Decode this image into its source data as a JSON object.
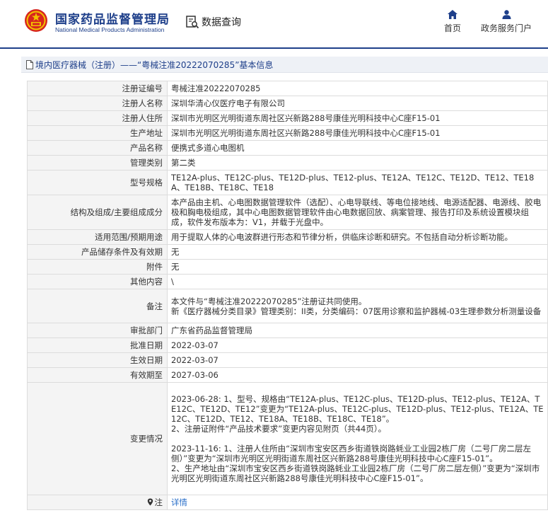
{
  "header": {
    "brand_cn": "国家药品监督管理局",
    "brand_en": "National Medical Products Administration",
    "query_label": "数据查询",
    "nav": {
      "home": "首页",
      "portal": "政务服务门户"
    },
    "accent_color": "#1e3f8a"
  },
  "breadcrumb": {
    "text": "境内医疗器械（注册）——“粤械注准20222070285”基本信息"
  },
  "rows": [
    {
      "label": "注册证编号",
      "value": "粤械注准20222070285"
    },
    {
      "label": "注册人名称",
      "value": "深圳华清心仪医疗电子有限公司"
    },
    {
      "label": "注册人住所",
      "value": "深圳市光明区光明街道东周社区兴新路288号康佳光明科技中心C座F15-01"
    },
    {
      "label": "生产地址",
      "value": "深圳市光明区光明街道东周社区兴新路288号康佳光明科技中心C座F15-01"
    },
    {
      "label": "产品名称",
      "value": "便携式多道心电图机"
    },
    {
      "label": "管理类别",
      "value": "第二类"
    },
    {
      "label": "型号规格",
      "value": "TE12A-plus、TE12C-plus、TE12D-plus、TE12-plus、TE12A、TE12C、TE12D、TE12、TE18A、TE18B、TE18C、TE18"
    },
    {
      "label": "结构及组成/主要组成成分",
      "value": "本产品由主机、心电图数据管理软件（选配）、心电导联线、等电位接地线、电源适配器、电源线、胶电极和胸电极组成，其中心电图数据管理软件由心电数据回放、病案管理、报告打印及系统设置模块组成，软件发布版本为：V1，并载于光盘中。"
    },
    {
      "label": "适用范围/预期用途",
      "value": "用于提取人体的心电波群进行形态和节律分析，供临床诊断和研究。不包括自动分析诊断功能。"
    },
    {
      "label": "产品储存条件及有效期",
      "value": "无"
    },
    {
      "label": "附件",
      "value": "无"
    },
    {
      "label": "其他内容",
      "value": "\\"
    },
    {
      "label": "备注",
      "lines": [
        "本文件与“粤械注准20222070285”注册证共同使用。",
        "新《医疗器械分类目录》管理类别：II类，分类编码：07医用诊察和监护器械-03生理参数分析测量设备"
      ]
    },
    {
      "label": "审批部门",
      "value": "广东省药品监督管理局"
    },
    {
      "label": "批准日期",
      "value": "2022-03-07"
    },
    {
      "label": "生效日期",
      "value": "2022-03-07"
    },
    {
      "label": "有效期至",
      "value": "2027-03-06"
    },
    {
      "label": "变更情况",
      "lines": [
        "2023-06-28: 1、型号、规格由“TE12A-plus、TE12C-plus、TE12D-plus、TE12-plus、TE12A、TE12C、TE12D、TE12”变更为“TE12A-plus、TE12C-plus、TE12D-plus、TE12-plus、TE12A、TE12C、TE12D、TE12、TE18A、TE18B、TE18C、TE18”。",
        "2、注册证附件“产品技术要求”变更内容见附页（共44页）。",
        "",
        "2023-11-16: 1、注册人住所由“深圳市宝安区西乡街道铁岗路蚝业工业园2栋厂房（二号厂房二层左侧）”变更为“深圳市光明区光明街道东周社区兴新路288号康佳光明科技中心C座F15-01”。",
        "2、生产地址由“深圳市宝安区西乡街道铁岗路蚝业工业园2栋厂房（二号厂房二层左侧）”变更为“深圳市光明区光明街道东周社区兴新路288号康佳光明科技中心C座F15-01”。"
      ]
    }
  ],
  "note_row": {
    "label": "注",
    "link": "详情"
  }
}
